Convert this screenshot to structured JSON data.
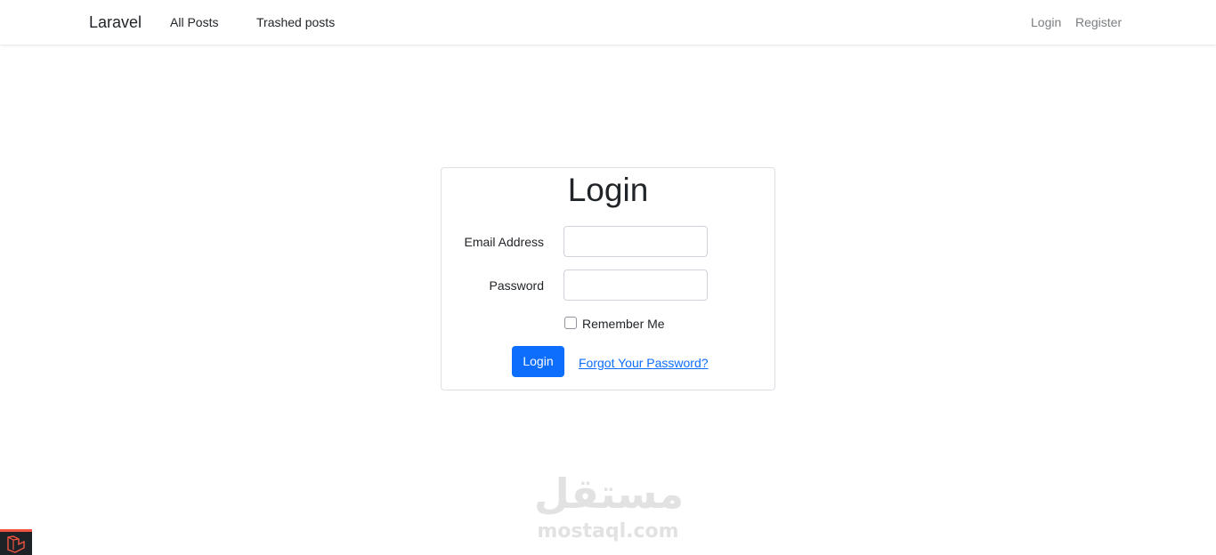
{
  "navbar": {
    "brand": "Laravel",
    "links": [
      {
        "label": "All Posts"
      },
      {
        "label": "Trashed posts"
      }
    ],
    "auth": {
      "login": "Login",
      "register": "Register"
    }
  },
  "login_card": {
    "title": "Login",
    "email": {
      "label": "Email Address",
      "value": "",
      "placeholder": ""
    },
    "password": {
      "label": "Password",
      "value": "",
      "placeholder": ""
    },
    "remember": {
      "label": "Remember Me",
      "checked": false
    },
    "submit_label": "Login",
    "forgot_label": "Forgot Your Password?"
  },
  "watermark": {
    "arabic": "مستقل",
    "latin": "mostaql.com"
  },
  "colors": {
    "primary": "#0d6efd",
    "nav_muted": "#7a7d80",
    "card_border": "#dcdfe3",
    "badge_bg": "#1d2227",
    "badge_accent": "#f05340"
  },
  "icons": {
    "corner_badge": "laravel-logo-icon"
  }
}
